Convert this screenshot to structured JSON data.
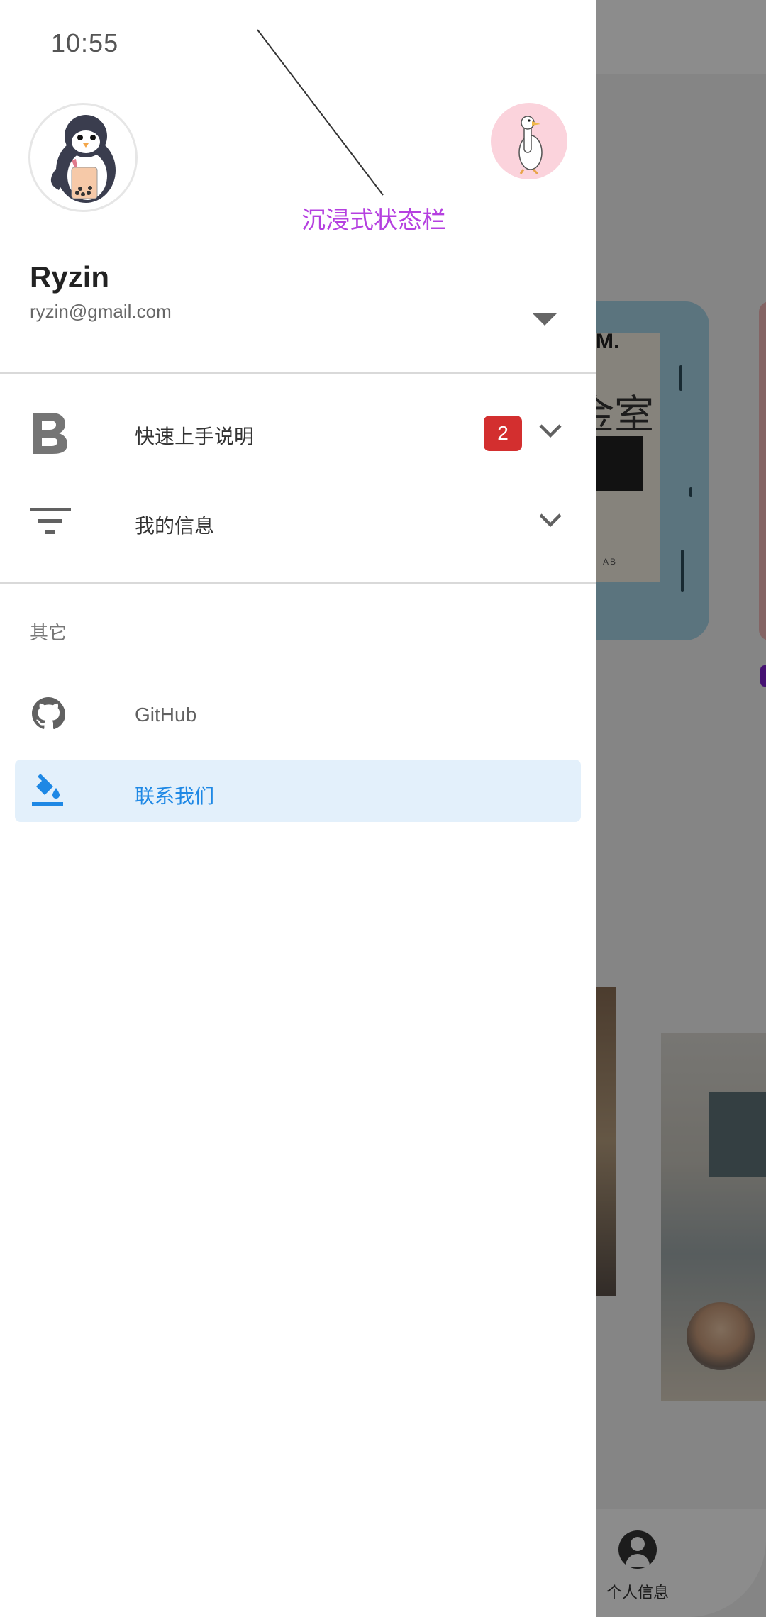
{
  "status_bar": {
    "time": "10:55"
  },
  "annotation": {
    "label": "沉浸式状态栏"
  },
  "drawer": {
    "user": {
      "name": "Ryzin",
      "email": "ryzin@gmail.com"
    },
    "menu": [
      {
        "label": "快速上手说明",
        "icon": "bold-b-icon",
        "badge": "2",
        "expandable": true
      },
      {
        "label": "我的信息",
        "icon": "filter-icon",
        "expandable": true
      }
    ],
    "section_header": "其它",
    "other_items": [
      {
        "label": "GitHub",
        "icon": "github-icon",
        "active": false
      },
      {
        "label": "联系我们",
        "icon": "paint-bucket-icon",
        "active": true
      }
    ]
  },
  "background_app": {
    "bottom_nav_label": "个人信息",
    "card_text_top": "M.",
    "card_text_main": "金室",
    "card_text_small": "AB"
  },
  "colors": {
    "accent": "#1e88e5",
    "active_row_bg": "#e3f0fb",
    "badge": "#d32f2f",
    "annotation": "#b540e0"
  }
}
